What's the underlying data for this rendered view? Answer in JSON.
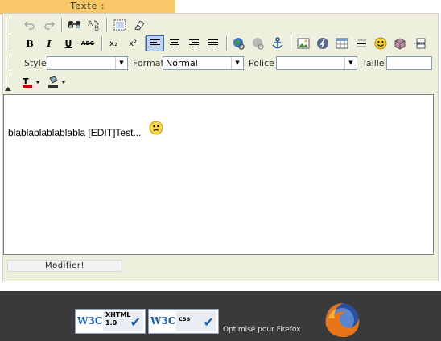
{
  "header": {
    "title": "Texte :"
  },
  "toolbar": {
    "row1": [
      "undo-icon",
      "redo-icon",
      "find-icon",
      "replace-icon",
      "select-all-icon",
      "remove-format-icon"
    ],
    "row2_labels": {
      "bold": "B",
      "italic": "I",
      "underline": "U",
      "strike": "ABC",
      "subscript": "x₂",
      "superscript": "x²"
    },
    "row3": {
      "style_label": "Style",
      "style_value": "",
      "format_label": "Format",
      "format_value": "Normal",
      "font_label": "Police",
      "font_value": "",
      "size_label": "Taille",
      "size_value": ""
    }
  },
  "content": {
    "text": "blablablablablabla [EDIT]Test..."
  },
  "actions": {
    "modify_label": "Modifier!"
  },
  "footer": {
    "xhtml_badge": {
      "brand": "W3C",
      "line1": "XHTML",
      "line2": "1.0"
    },
    "css_badge": {
      "brand": "W3C",
      "line1": "css"
    },
    "firefox_text": "Optimisé pour Firefox"
  },
  "colors": {
    "tab": "#f7c768",
    "toolbar_bg": "#efefde",
    "footer_bg": "#3a3a3a",
    "active_btn": "#c1d2ee"
  }
}
